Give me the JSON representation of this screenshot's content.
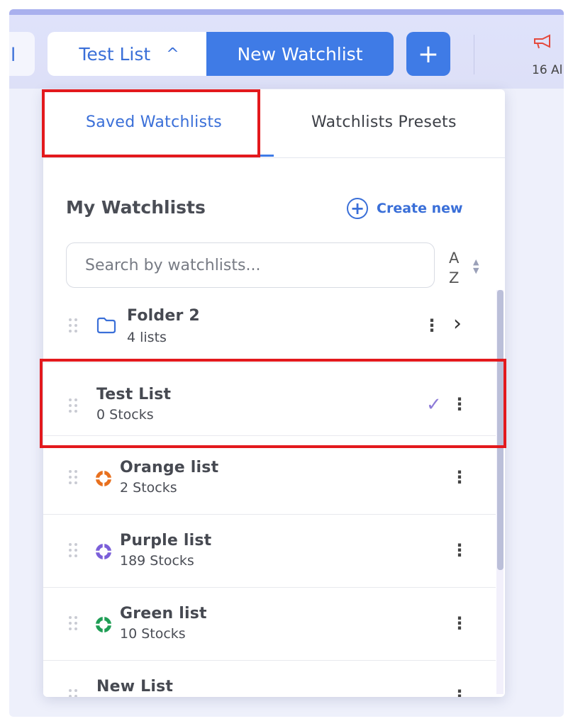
{
  "topbar": {
    "prev_tab_label": "l",
    "current_list": "Test List",
    "new_watchlist_label": "New Watchlist",
    "add_label": "+",
    "alerts_count": "16 Al"
  },
  "panel": {
    "tabs": [
      {
        "label": "Saved Watchlists",
        "active": true
      },
      {
        "label": "Watchlists Presets",
        "active": false
      }
    ],
    "section_title": "My Watchlists",
    "create_new_label": "Create new",
    "search_placeholder": "Search by watchlists...",
    "sort": {
      "top": "A",
      "bottom": "Z"
    },
    "rows": [
      {
        "type": "folder",
        "name": "Folder 2",
        "sub": "4 lists",
        "icon": "folder-icon",
        "color": "#3a6fd8"
      },
      {
        "type": "list",
        "name": "Test List",
        "sub": "0 Stocks",
        "selected": true
      },
      {
        "type": "list",
        "name": "Orange list",
        "sub": "2 Stocks",
        "icon": "life-ring-icon",
        "color": "#e8701e"
      },
      {
        "type": "list",
        "name": "Purple list",
        "sub": "189 Stocks",
        "icon": "life-ring-icon",
        "color": "#7b5fd9"
      },
      {
        "type": "list",
        "name": "Green list",
        "sub": "10 Stocks",
        "icon": "life-ring-icon",
        "color": "#1f9d55"
      },
      {
        "type": "list",
        "name": "New List",
        "sub": ""
      }
    ]
  },
  "colors": {
    "accent": "#3f7be6",
    "highlight": "#e3191d",
    "check": "#8d7bd8"
  }
}
